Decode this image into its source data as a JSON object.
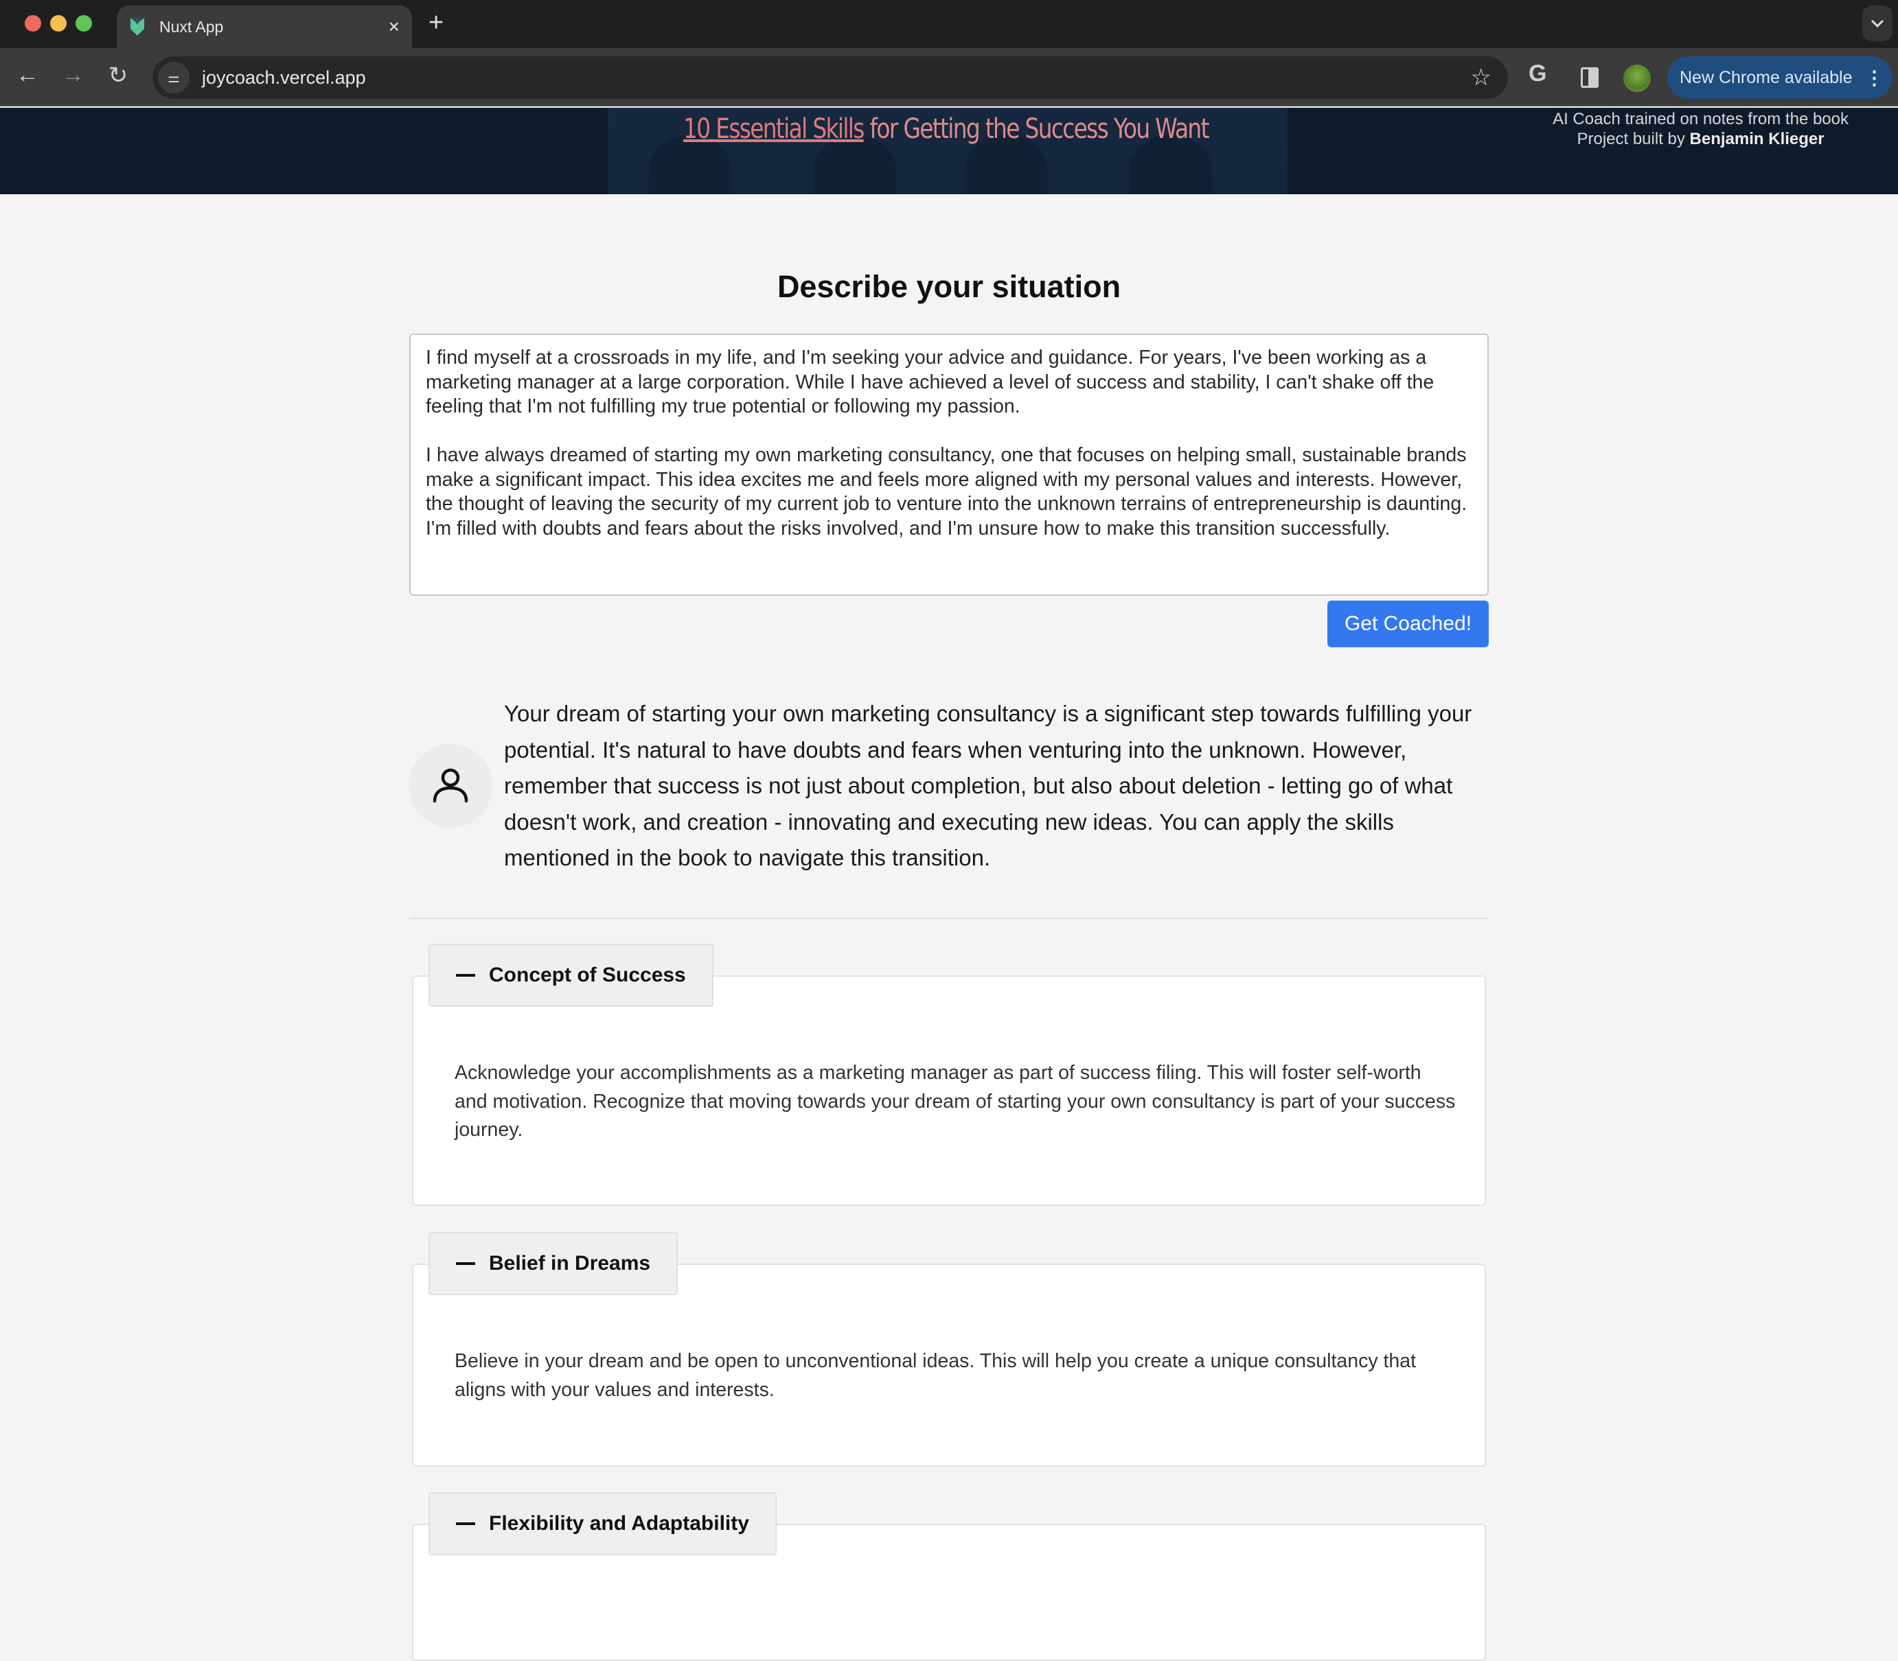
{
  "browser": {
    "tab_title": "Nuxt App",
    "url": "joycoach.vercel.app",
    "update_label": "New Chrome available",
    "icons": {
      "favicon": "nuxt-logo-icon",
      "close": "close-icon",
      "new_tab": "plus-icon",
      "tab_list": "chevron-down-icon",
      "back": "arrow-left-icon",
      "forward": "arrow-right-icon",
      "reload": "reload-icon",
      "site_info": "tune-icon",
      "bookmark": "star-icon",
      "extension": "google-g-icon",
      "side_panel": "side-panel-icon",
      "profile": "profile-avatar-icon",
      "menu": "kebab-menu-icon"
    },
    "glyphs": {
      "close": "×",
      "new_tab": "+",
      "tab_list": "⌄",
      "back": "←",
      "forward": "→",
      "reload": "↻",
      "site_info": "⚌",
      "bookmark": "☆",
      "extension": "G",
      "menu": "⋮"
    }
  },
  "banner": {
    "title_highlight": "10 Essential Skills",
    "title_rest": " for Getting the Success You Want",
    "credit_line1": "AI Coach trained on notes from the book",
    "credit_line2_prefix": "Project built by ",
    "credit_author": "Benjamin Klieger"
  },
  "main": {
    "heading": "Describe your situation",
    "situation_text": "I find myself at a crossroads in my life, and I'm seeking your advice and guidance. For years, I've been working as a marketing manager at a large corporation. While I have achieved a level of success and stability, I can't shake off the feeling that I'm not fulfilling my true potential or following my passion.\n\nI have always dreamed of starting my own marketing consultancy, one that focuses on helping small, sustainable brands make a significant impact. This idea excites me and feels more aligned with my personal values and interests. However, the thought of leaving the security of my current job to venture into the unknown terrains of entrepreneurship is daunting. I'm filled with doubts and fears about the risks involved, and I'm unsure how to make this transition successfully.",
    "submit_label": "Get Coached!",
    "response_text": "Your dream of starting your own marketing consultancy is a significant step towards fulfilling your potential. It's natural to have doubts and fears when venturing into the unknown. However, remember that success is not just about completion, but also about deletion - letting go of what doesn't work, and creation - innovating and executing new ideas. You can apply the skills mentioned in the book to navigate this transition.",
    "accent_color": "#3478f0"
  },
  "skills": [
    {
      "title": "Concept of Success",
      "body": "Acknowledge your accomplishments as a marketing manager as part of success filing. This will foster self-worth and motivation. Recognize that moving towards your dream of starting your own consultancy is part of your success journey."
    },
    {
      "title": "Belief in Dreams",
      "body": "Believe in your dream and be open to unconventional ideas. This will help you create a unique consultancy that aligns with your values and interests."
    },
    {
      "title": "Flexibility and Adaptability",
      "body": ""
    }
  ]
}
